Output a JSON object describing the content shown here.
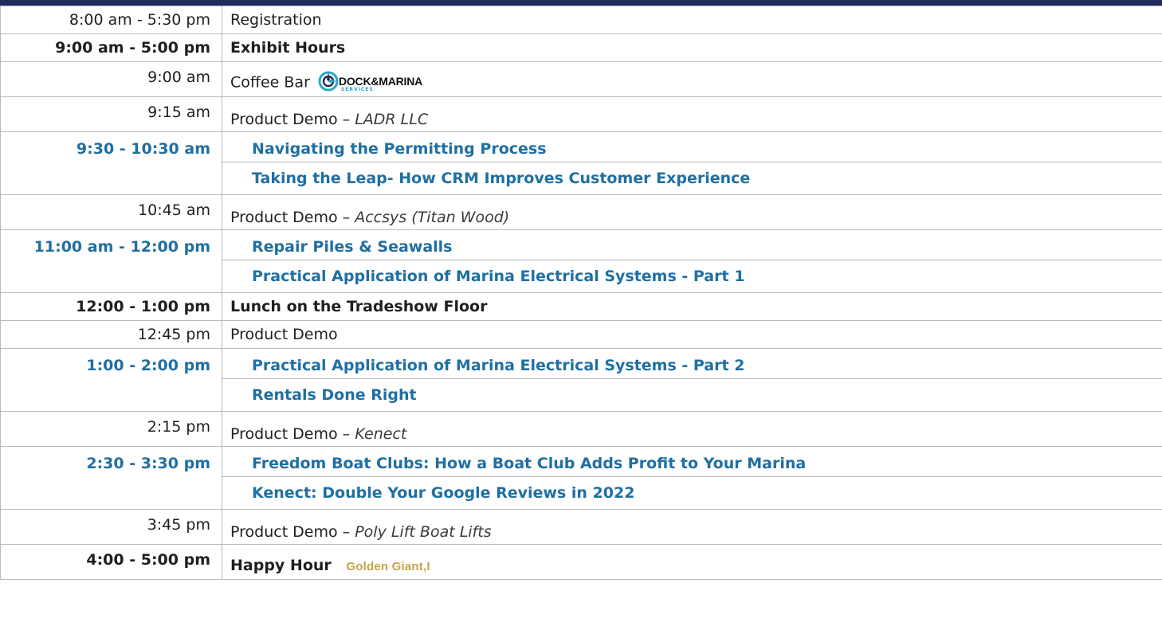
{
  "rows": [
    {
      "time": "8:00 am - 5:30 pm",
      "event": "Registration"
    },
    {
      "time": "9:00 am - 5:00 pm",
      "event": "Exhibit Hours"
    },
    {
      "time": "9:00 am",
      "event": "Coffee Bar",
      "logo_text": "DOCK&MARINA",
      "logo_sub": "SERVICES"
    },
    {
      "time": "9:15 am",
      "event": "Product Demo – ",
      "sponsor": "LADR LLC"
    },
    {
      "time": "9:30 - 10:30 am",
      "sessions": [
        "Navigating the Permitting Process",
        "Taking the Leap- How CRM Improves Customer Experience"
      ]
    },
    {
      "time": "10:45 am",
      "event": "Product Demo – ",
      "sponsor": "Accsys (Titan Wood)"
    },
    {
      "time": "11:00 am - 12:00 pm",
      "sessions": [
        "Repair Piles & Seawalls",
        "Practical Application of Marina Electrical Systems - Part 1"
      ]
    },
    {
      "time": "12:00 - 1:00 pm",
      "event": "Lunch on the Tradeshow Floor"
    },
    {
      "time": "12:45 pm",
      "event": "Product Demo"
    },
    {
      "time": "1:00 - 2:00 pm",
      "sessions": [
        "Practical Application of Marina Electrical Systems - Part 2",
        "Rentals Done Right"
      ]
    },
    {
      "time": "2:15 pm",
      "event": "Product Demo – ",
      "sponsor": "Kenect"
    },
    {
      "time": "2:30 - 3:30 pm",
      "sessions": [
        "Freedom Boat Clubs: How a Boat Club Adds Profit to Your Marina",
        "Kenect: Double Your Google Reviews in 2022"
      ]
    },
    {
      "time": "3:45 pm",
      "event": "Product Demo – ",
      "sponsor": "Poly Lift Boat Lifts"
    },
    {
      "time": "4:00 - 5:00 pm",
      "event": "Happy Hour",
      "logo_text": "Golden Giant,I"
    }
  ],
  "colors": {
    "header_bar": "#1f2c5a",
    "session_blue": "#1f6fa3",
    "border": "#b9b9b9",
    "logo_gold": "#c6a24a",
    "logo_teal": "#2ba7c7"
  }
}
